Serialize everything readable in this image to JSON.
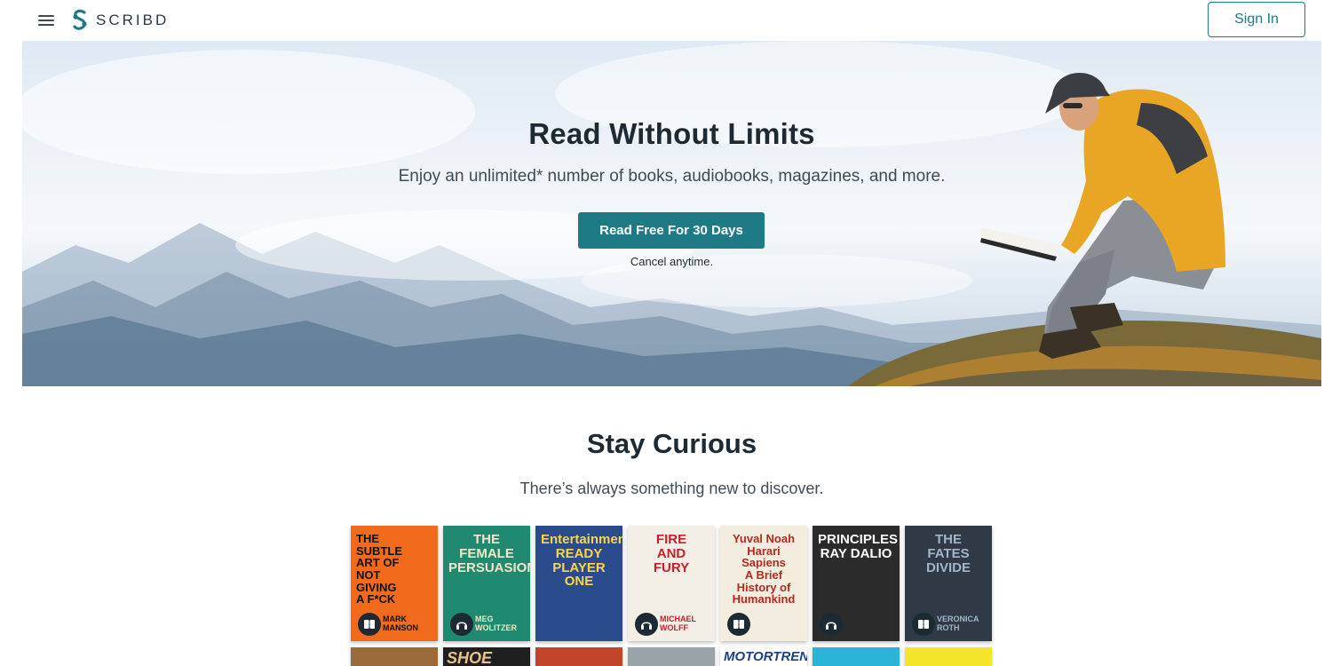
{
  "header": {
    "logo_text": "SCRIBD",
    "sign_in_label": "Sign In",
    "menu_icon": "hamburger-menu-icon",
    "logo_icon": "scribd-logo-icon"
  },
  "hero": {
    "title": "Read Without Limits",
    "subtitle": "Enjoy an unlimited* number of books, audiobooks, magazines, and more.",
    "cta_label": "Read Free For 30 Days",
    "cancel_note": "Cancel anytime."
  },
  "curious": {
    "title": "Stay Curious",
    "subtitle": "There’s always something new to discover."
  },
  "books": [
    {
      "lines": [
        "THE",
        "SUBTLE",
        "ART OF",
        "NOT",
        "GIVING",
        "A F*CK"
      ],
      "author": "MARK MANSON",
      "bg": "#f26a1b",
      "badge": "book-icon"
    },
    {
      "lines": [
        "THE",
        "FEMALE",
        "PERSUASION"
      ],
      "author": "MEG WOLITZER",
      "bg": "#1f8a70",
      "badge": "headphones-icon"
    },
    {
      "lines": [
        "Entertainment",
        "READY",
        "PLAYER",
        "ONE"
      ],
      "author": "",
      "bg": "#2a4b8c",
      "badge": ""
    },
    {
      "lines": [
        "FIRE",
        "AND",
        "FURY"
      ],
      "author": "MICHAEL WOLFF",
      "bg": "#f4efe6",
      "badge": "headphones-icon"
    },
    {
      "lines": [
        "Yuval Noah Harari",
        "Sapiens",
        "A Brief",
        "History of",
        "Humankind"
      ],
      "author": "",
      "bg": "#f3ede0",
      "badge": "book-icon"
    },
    {
      "lines": [
        "PRINCIPLES",
        "RAY DALIO"
      ],
      "author": "",
      "bg": "#2b2b2b",
      "badge": "headphones-icon"
    },
    {
      "lines": [
        "THE",
        "FATES",
        "DIVIDE"
      ],
      "author": "VERONICA ROTH",
      "bg": "#2f3a44",
      "badge": "book-icon"
    }
  ],
  "row2_books": [
    {
      "text": "",
      "bg": "#9b6a3a"
    },
    {
      "text": "SHOE",
      "bg": "#1f1f1f"
    },
    {
      "text": "",
      "bg": "#c0452b"
    },
    {
      "text": "",
      "bg": "#9aa3a8"
    },
    {
      "text": "MOTORTREND",
      "bg": "#ffffff"
    },
    {
      "text": "",
      "bg": "#29b4d8"
    },
    {
      "text": "",
      "bg": "#f4e42a"
    }
  ],
  "colors": {
    "accent": "#1e7b85",
    "text_dark": "#1e2a33"
  }
}
